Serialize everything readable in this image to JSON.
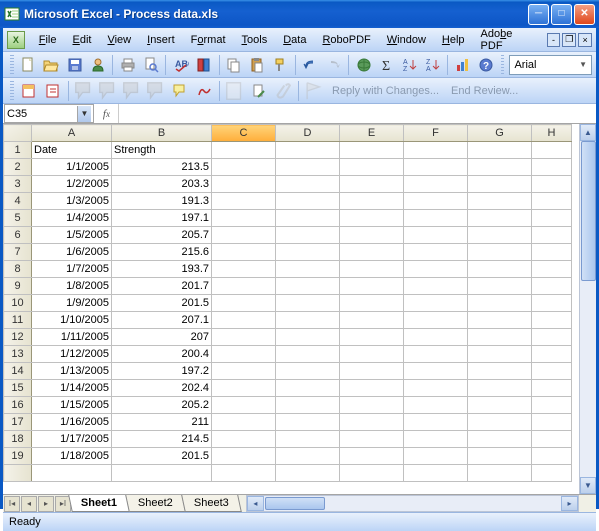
{
  "window": {
    "title": "Microsoft Excel - Process data.xls"
  },
  "menu": {
    "file": "File",
    "edit": "Edit",
    "view": "View",
    "insert": "Insert",
    "format": "Format",
    "tools": "Tools",
    "data": "Data",
    "robopdf": "RoboPDF",
    "window": "Window",
    "help": "Help",
    "adobepdf": "Adobe PDF"
  },
  "toolbar": {
    "font": "Arial",
    "reply": "Reply with Changes...",
    "endreview": "End Review..."
  },
  "namebox": {
    "value": "C35"
  },
  "status": {
    "text": "Ready"
  },
  "sheets": {
    "s1": "Sheet1",
    "s2": "Sheet2",
    "s3": "Sheet3"
  },
  "headers": {
    "date": "Date",
    "strength": "Strength"
  },
  "cols": [
    "A",
    "B",
    "C",
    "D",
    "E",
    "F",
    "G",
    "H"
  ],
  "rows": [
    {
      "n": 1,
      "date": "Date",
      "strength": "Strength",
      "header": true
    },
    {
      "n": 2,
      "date": "1/1/2005",
      "strength": "213.5"
    },
    {
      "n": 3,
      "date": "1/2/2005",
      "strength": "203.3"
    },
    {
      "n": 4,
      "date": "1/3/2005",
      "strength": "191.3"
    },
    {
      "n": 5,
      "date": "1/4/2005",
      "strength": "197.1"
    },
    {
      "n": 6,
      "date": "1/5/2005",
      "strength": "205.7"
    },
    {
      "n": 7,
      "date": "1/6/2005",
      "strength": "215.6"
    },
    {
      "n": 8,
      "date": "1/7/2005",
      "strength": "193.7"
    },
    {
      "n": 9,
      "date": "1/8/2005",
      "strength": "201.7"
    },
    {
      "n": 10,
      "date": "1/9/2005",
      "strength": "201.5"
    },
    {
      "n": 11,
      "date": "1/10/2005",
      "strength": "207.1"
    },
    {
      "n": 12,
      "date": "1/11/2005",
      "strength": "207"
    },
    {
      "n": 13,
      "date": "1/12/2005",
      "strength": "200.4"
    },
    {
      "n": 14,
      "date": "1/13/2005",
      "strength": "197.2"
    },
    {
      "n": 15,
      "date": "1/14/2005",
      "strength": "202.4"
    },
    {
      "n": 16,
      "date": "1/15/2005",
      "strength": "205.2"
    },
    {
      "n": 17,
      "date": "1/16/2005",
      "strength": "211"
    },
    {
      "n": 18,
      "date": "1/17/2005",
      "strength": "214.5"
    },
    {
      "n": 19,
      "date": "1/18/2005",
      "strength": "201.5"
    }
  ]
}
